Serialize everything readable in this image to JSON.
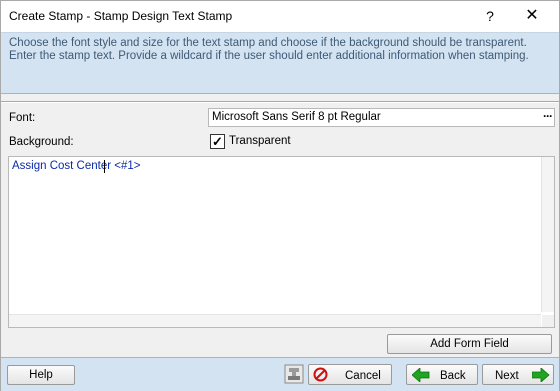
{
  "window": {
    "title": "Create Stamp - Stamp Design Text Stamp",
    "help_glyph": "?",
    "close_glyph": "✕"
  },
  "instructions": "Choose the font style and size for the text stamp and choose if the background should be transparent. Enter the stamp text. Provide a wildcard if the  user should enter additional information when stamping.",
  "form": {
    "font_label": "Font:",
    "font_value": "Microsoft Sans Serif 8 pt Regular",
    "font_browse": "···",
    "background_label": "Background:",
    "transparent_label": "Transparent",
    "transparent_checked": true,
    "check_glyph": "✓"
  },
  "stamp_text": "Assign Cost Center <#1>",
  "buttons": {
    "add_form_field": "Add Form Field",
    "help": "Help",
    "cancel": "Cancel",
    "back": "Back",
    "next": "Next"
  },
  "colors": {
    "instruction_bg": "#d3e3f2",
    "instruction_text": "#3e5a75",
    "stamp_text": "#0b2ba8",
    "cancel_icon": "#d01010",
    "arrow_green": "#1fa51f"
  }
}
